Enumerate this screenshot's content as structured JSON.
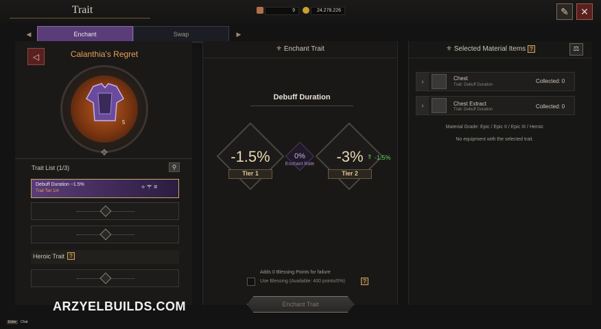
{
  "header": {
    "title": "Trait",
    "resource1_value": "9",
    "resource2_value": "24.278.226"
  },
  "tabs": [
    {
      "label": "Enchant",
      "active": true
    },
    {
      "label": "Swap",
      "active": false
    }
  ],
  "item": {
    "name": "Calanthia's Regret",
    "level": "5"
  },
  "trait_list": {
    "title": "Trait List (1/3)",
    "selected_name": "Debuff Duration −1.5%",
    "selected_tier": "Trait Tier 1/4",
    "heroic_label": "Heroic Trait"
  },
  "enchant": {
    "header": "Enchant Trait",
    "trait_name": "Debuff Duration",
    "tier1_value": "-1.5%",
    "tier1_label": "Tier 1",
    "rate_value": "0%",
    "rate_label": "Enchant Rate",
    "tier2_value": "-3%",
    "tier2_label": "Tier 2",
    "delta": "-1.5%",
    "blessing_note": "Adds 0 Blessing Points for failure",
    "use_blessing": "Use Blessing (Available: 400 points/0%)",
    "button_label": "Enchant Trait"
  },
  "materials": {
    "header": "Selected Material Items",
    "items": [
      {
        "name": "Chest",
        "trait": "Trait: Debuff Duration",
        "collected": "Collected: 0"
      },
      {
        "name": "Chest Extract",
        "trait": "Trait: Debuff Duration",
        "collected": "Collected: 0"
      }
    ],
    "grade": "Material Grade: Epic / Epic II / Epic III / Heroic",
    "empty_message": "No equipment with the selected trait."
  },
  "watermark": "ARZYELBUILDS.COM",
  "footer": {
    "key": "Enter",
    "action": "Chat"
  },
  "colors": {
    "accent_purple": "#5a3d78",
    "gold": "#c9a86a",
    "green": "#5fd35f"
  }
}
